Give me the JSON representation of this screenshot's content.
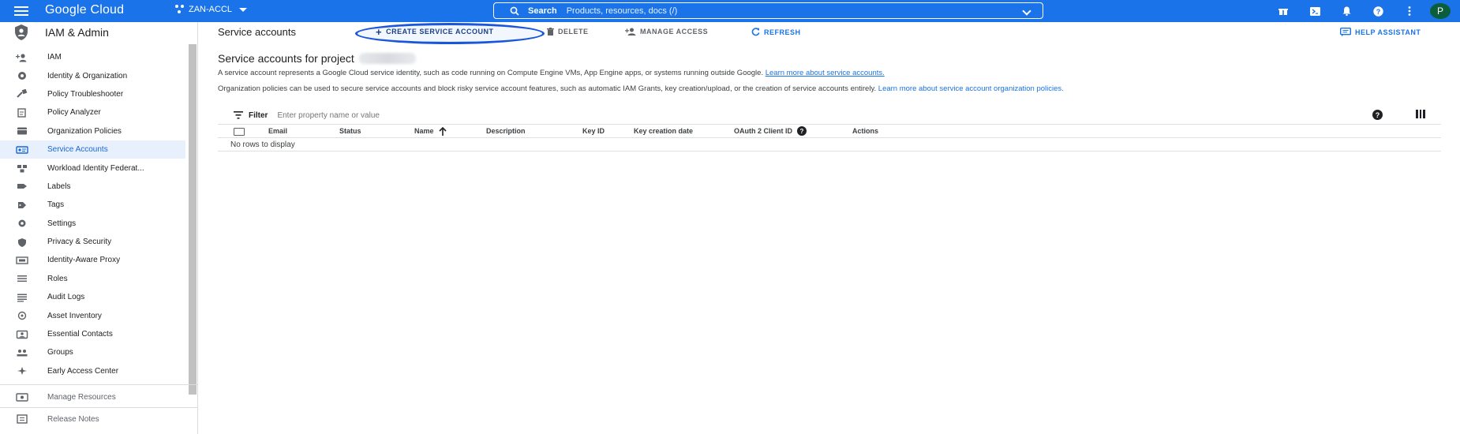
{
  "topbar": {
    "brand": "Google Cloud",
    "project": "ZAN-ACCL",
    "search_label": "Search",
    "search_placeholder": "Products, resources, docs (/)",
    "avatar_initial": "P"
  },
  "sidebar": {
    "title": "IAM & Admin",
    "items": [
      {
        "label": "IAM",
        "icon": "person-add-icon"
      },
      {
        "label": "Identity & Organization",
        "icon": "identity-icon"
      },
      {
        "label": "Policy Troubleshooter",
        "icon": "wrench-icon"
      },
      {
        "label": "Policy Analyzer",
        "icon": "policy-analyzer-icon"
      },
      {
        "label": "Organization Policies",
        "icon": "org-policies-icon"
      },
      {
        "label": "Service Accounts",
        "icon": "service-accounts-icon",
        "active": true
      },
      {
        "label": "Workload Identity Federat...",
        "icon": "workload-icon"
      },
      {
        "label": "Labels",
        "icon": "label-icon"
      },
      {
        "label": "Tags",
        "icon": "tag-icon"
      },
      {
        "label": "Settings",
        "icon": "gear-icon"
      },
      {
        "label": "Privacy & Security",
        "icon": "shield-icon"
      },
      {
        "label": "Identity-Aware Proxy",
        "icon": "proxy-icon"
      },
      {
        "label": "Roles",
        "icon": "roles-icon"
      },
      {
        "label": "Audit Logs",
        "icon": "list-icon"
      },
      {
        "label": "Asset Inventory",
        "icon": "asset-icon"
      },
      {
        "label": "Essential Contacts",
        "icon": "contacts-icon"
      },
      {
        "label": "Groups",
        "icon": "groups-icon"
      },
      {
        "label": "Early Access Center",
        "icon": "early-access-icon"
      }
    ],
    "manage_resources": "Manage Resources",
    "release_notes": "Release Notes"
  },
  "toolbar": {
    "title": "Service accounts",
    "create": "CREATE SERVICE ACCOUNT",
    "delete": "DELETE",
    "manage_access": "MANAGE ACCESS",
    "refresh": "REFRESH",
    "help_assistant": "HELP ASSISTANT"
  },
  "content": {
    "heading": "Service accounts for project",
    "description": "A service account represents a Google Cloud service identity, such as code running on Compute Engine VMs, App Engine apps, or systems running outside Google.",
    "description_link": "Learn more about service accounts.",
    "org_text": "Organization policies can be used to secure service accounts and block risky service account features, such as automatic IAM Grants, key creation/upload, or the creation of service accounts entirely.",
    "org_link": "Learn more about service account organization policies."
  },
  "filter": {
    "label": "Filter",
    "placeholder": "Enter property name or value"
  },
  "table": {
    "columns": [
      "Email",
      "Status",
      "Name",
      "Description",
      "Key ID",
      "Key creation date",
      "OAuth 2 Client ID",
      "Actions"
    ],
    "empty": "No rows to display"
  },
  "colors": {
    "accent": "#1a73e8",
    "active_bg": "#e8f0fe",
    "highlight_oval": "#1a56db"
  }
}
